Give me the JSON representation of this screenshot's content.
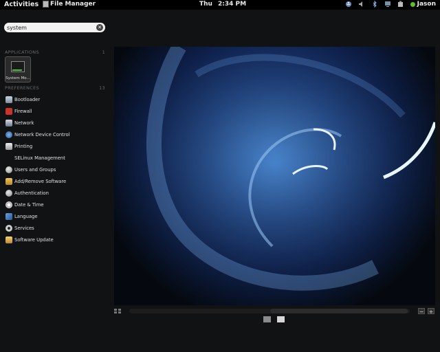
{
  "topbar": {
    "activities": "Activities",
    "app_name": "File Manager",
    "day": "Thu",
    "time": "2:34 PM",
    "user": "Jason",
    "status_color": "#5fbf2c"
  },
  "search": {
    "value": "system"
  },
  "applications": {
    "header": "APPLICATIONS",
    "count": "1",
    "items": [
      {
        "label": "System Mo..."
      }
    ]
  },
  "preferences": {
    "header": "PREFERENCES",
    "count": "13",
    "items": [
      {
        "label": "Bootloader",
        "icon": "bootloader-icon"
      },
      {
        "label": "Firewall",
        "icon": "firewall-icon"
      },
      {
        "label": "Network",
        "icon": "network-icon"
      },
      {
        "label": "Network Device Control",
        "icon": "network-device-icon"
      },
      {
        "label": "Printing",
        "icon": "printer-icon"
      },
      {
        "label": "SELinux Management",
        "icon": "selinux-icon"
      },
      {
        "label": "Users and Groups",
        "icon": "users-icon"
      },
      {
        "label": "Add/Remove Software",
        "icon": "software-icon"
      },
      {
        "label": "Authentication",
        "icon": "authentication-icon"
      },
      {
        "label": "Date & Time",
        "icon": "clock-icon"
      },
      {
        "label": "Language",
        "icon": "language-icon"
      },
      {
        "label": "Services",
        "icon": "services-icon"
      },
      {
        "label": "Software Update",
        "icon": "software-update-icon"
      }
    ]
  },
  "workspace_controls": {
    "zoom_out": "−",
    "zoom_in": "+"
  }
}
